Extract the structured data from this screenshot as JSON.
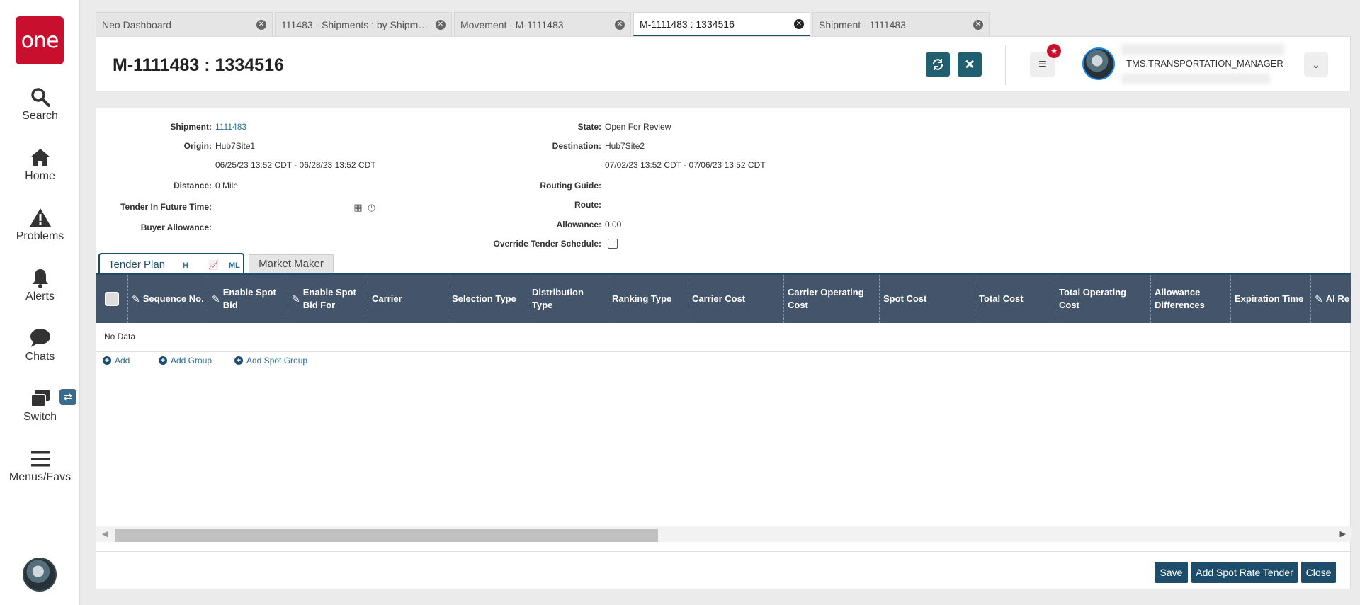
{
  "app": {
    "logo_text": "one"
  },
  "nav": {
    "items": [
      {
        "label": "Search",
        "icon": "search-icon"
      },
      {
        "label": "Home",
        "icon": "home-icon"
      },
      {
        "label": "Problems",
        "icon": "warning-icon"
      },
      {
        "label": "Alerts",
        "icon": "bell-icon"
      },
      {
        "label": "Chats",
        "icon": "chat-icon"
      },
      {
        "label": "Switch",
        "icon": "switch-icon"
      },
      {
        "label": "Menus/Favs",
        "icon": "hamburger-icon"
      }
    ]
  },
  "tabs": [
    {
      "label": "Neo Dashboard",
      "active": false
    },
    {
      "label": "111483 - Shipments : by Shipme...",
      "active": false
    },
    {
      "label": "Movement - M-1111483",
      "active": false
    },
    {
      "label": "M-1111483 : 1334516",
      "active": true
    },
    {
      "label": "Shipment - 1111483",
      "active": false
    }
  ],
  "header": {
    "title": "M-1111483 : 1334516",
    "user_name": "TMS.TRANSPORTATION_MANAGER"
  },
  "form": {
    "shipment_label": "Shipment:",
    "shipment_value": "1111483",
    "origin_label": "Origin:",
    "origin_value": "Hub7Site1",
    "origin_dates": "06/25/23 13:52 CDT  -  06/28/23 13:52 CDT",
    "distance_label": "Distance:",
    "distance_value": "0 Mile",
    "tender_future_label": "Tender In Future Time:",
    "buyer_allowance_label": "Buyer Allowance:",
    "state_label": "State:",
    "state_value": "Open For Review",
    "destination_label": "Destination:",
    "destination_value": "Hub7Site2",
    "destination_dates": "07/02/23 13:52 CDT  -  07/06/23 13:52 CDT",
    "routing_guide_label": "Routing Guide:",
    "route_label": "Route:",
    "allowance_label": "Allowance:",
    "allowance_value": "0.00",
    "override_label": "Override Tender Schedule:"
  },
  "panel_tabs": {
    "active_label": "Tender Plan",
    "h_label": "H",
    "ml_label": "ML",
    "inactive_label": "Market Maker"
  },
  "grid": {
    "columns": [
      "Sequence No.",
      "Enable Spot Bid",
      "Enable Spot Bid For",
      "Carrier",
      "Selection Type",
      "Distribution Type",
      "Ranking Type",
      "Carrier Cost",
      "Carrier Operating Cost",
      "Spot Cost",
      "Total Cost",
      "Total Operating Cost",
      "Allowance Differences",
      "Expiration Time",
      "Al Re Ti"
    ],
    "empty_text": "No Data"
  },
  "actions": {
    "add": "Add",
    "add_group": "Add Group",
    "add_spot_group": "Add Spot Group"
  },
  "footer": {
    "save": "Save",
    "add_spot_rate_tender": "Add Spot Rate Tender",
    "close": "Close"
  },
  "colors": {
    "brand": "#c8102e",
    "accent": "#1e4d6b",
    "grid_header": "#44546a",
    "link": "#2a6f97"
  }
}
